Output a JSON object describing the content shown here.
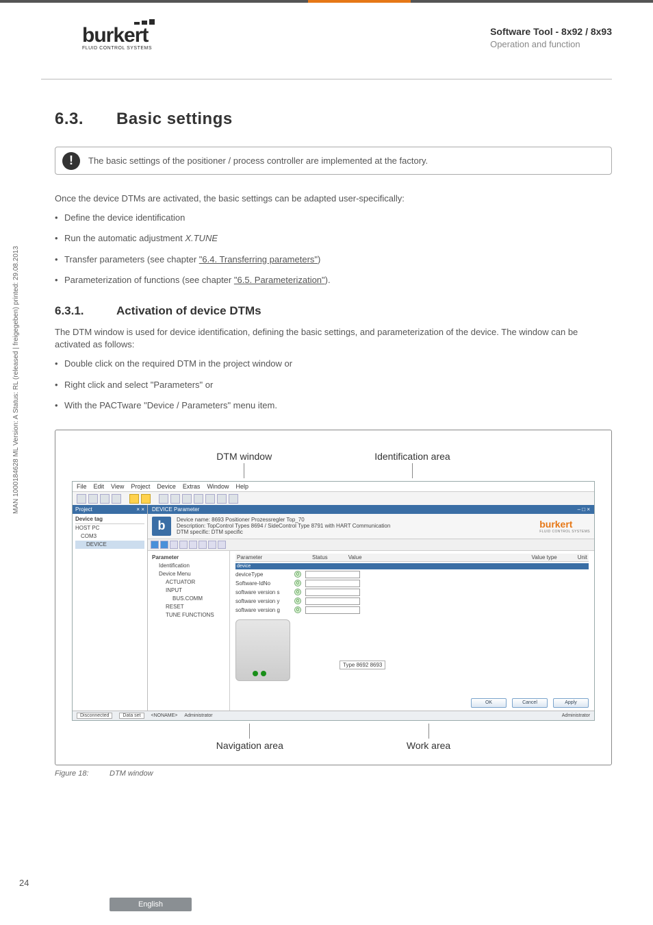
{
  "header": {
    "logo_text": "burkert",
    "logo_sub": "FLUID CONTROL SYSTEMS",
    "product": "Software Tool - 8x92 / 8x93",
    "subtitle": "Operation and function"
  },
  "side_vertical": "MAN 1000184628 ML Version: A Status: RL (released | freigegeben) printed: 29.08.2013",
  "section": {
    "num": "6.3.",
    "title": "Basic settings",
    "note": "The basic settings of the positioner / process controller are implemented at the factory.",
    "intro": "Once the device DTMs are activated, the basic settings can be adapted user-specifically:",
    "bullets": [
      {
        "pre": "Define the device identification"
      },
      {
        "pre": "Run the automatic adjustment ",
        "italic": "X.TUNE"
      },
      {
        "pre": "Transfer parameters (see chapter ",
        "link": "\"6.4. Transferring parameters\"",
        "post": ")"
      },
      {
        "pre": "Parameterization of functions (see chapter ",
        "link": "\"6.5. Parameterization\"",
        "post": ")."
      }
    ]
  },
  "subsection": {
    "num": "6.3.1.",
    "title": "Activation of device DTMs",
    "para": "The DTM window is used for device identification, defining the basic settings, and parameterization of the device. The window can be activated as follows:",
    "bullets": [
      "Double click on the required DTM in the project window or",
      "Right click and select \"Parameters\" or",
      "With the PACTware \"Device / Parameters\" menu item."
    ]
  },
  "figure": {
    "top_labels": {
      "left": "DTM window",
      "right": "Identification area"
    },
    "bottom_labels": {
      "left": "Navigation area",
      "right": "Work area"
    },
    "caption_num": "Figure 18:",
    "caption_text": "DTM window"
  },
  "screenshot": {
    "menubar": [
      "File",
      "Edit",
      "View",
      "Project",
      "Device",
      "Extras",
      "Window",
      "Help"
    ],
    "project_panel": {
      "title": "Project",
      "close": "× ×",
      "col": "Device tag",
      "tree": [
        "HOST PC",
        "COM3",
        "DEVICE"
      ]
    },
    "param_panel": {
      "title": "DEVICE Parameter",
      "winbtns": "– □ ×",
      "icon": "b",
      "rows": {
        "device_name_label": "Device name:",
        "device_name_value": "8693 Positioner Prozessregler Top_70",
        "description_label": "Description:",
        "description_value": "TopControl Types 8694 / SideControl Type 8791 with HART Communication",
        "dtm_label": "DTM specific:",
        "dtm_value": "DTM specific"
      },
      "brand": "burkert",
      "brand_sub": "FLUID CONTROL SYSTEMS"
    },
    "nav_tree": {
      "root": "Parameter",
      "items": [
        "Identification",
        "Device Menu",
        "ACTUATOR",
        "INPUT",
        "BUS.COMM",
        "RESET",
        "TUNE FUNCTIONS"
      ]
    },
    "work": {
      "headers": [
        "Parameter",
        "Status",
        "Value",
        "Value type",
        "Unit"
      ],
      "device_row": "device",
      "params": [
        "deviceType",
        "Software-IdNo",
        "software version s",
        "software version y",
        "software version g"
      ],
      "circ": "0",
      "type_label": "Type 8692 8693",
      "buttons": [
        "OK",
        "Cancel",
        "Apply"
      ]
    },
    "status": {
      "disconnected": "Disconnected",
      "dataset": "Data set",
      "role_label": "Administrator",
      "noname": "<NONAME>",
      "admin": "Administrator"
    }
  },
  "page_number": "24",
  "language": "English"
}
